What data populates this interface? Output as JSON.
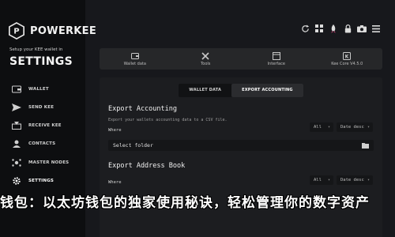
{
  "brand": {
    "name": "POWERKEE"
  },
  "sidebar": {
    "setup_text": "Setup your KEE wallet in",
    "title": "SETTINGS",
    "items": [
      {
        "label": "WALLET",
        "icon": "wallet-icon"
      },
      {
        "label": "SEND KEE",
        "icon": "send-icon"
      },
      {
        "label": "RECEIVE KEE",
        "icon": "receive-icon"
      },
      {
        "label": "CONTACTS",
        "icon": "contacts-icon"
      },
      {
        "label": "MASTER NODES",
        "icon": "nodes-icon"
      },
      {
        "label": "SETTINGS",
        "icon": "gear-icon",
        "active": true
      }
    ]
  },
  "topbar": {
    "icons": [
      "sync-icon",
      "grid-icon",
      "rocket-icon",
      "lock-icon",
      "camera-icon",
      "menu-icon"
    ]
  },
  "tabs": [
    {
      "label": "Wallet data",
      "icon": "wallet-data-icon"
    },
    {
      "label": "Tools",
      "icon": "tools-icon"
    },
    {
      "label": "Interface",
      "icon": "interface-icon"
    },
    {
      "label": "Kee Core V4.5.0",
      "icon": "core-icon"
    }
  ],
  "subtabs": [
    {
      "label": "WALLET DATA"
    },
    {
      "label": "EXPORT ACCOUNTING",
      "active": true
    }
  ],
  "export_accounting": {
    "title": "Export Accounting",
    "description": "Export your wallets accounting data to a CSV file.",
    "where_label": "Where",
    "filter_all": "All",
    "filter_date": "Date desc",
    "folder_placeholder": "Select folder"
  },
  "export_address_book": {
    "title": "Export Address Book",
    "where_label": "Where",
    "filter_all": "All",
    "filter_date": "Date desc"
  },
  "overlay_banner": "钱包：以太坊钱包的独家使用秘诀，轻松管理你的数字资产"
}
